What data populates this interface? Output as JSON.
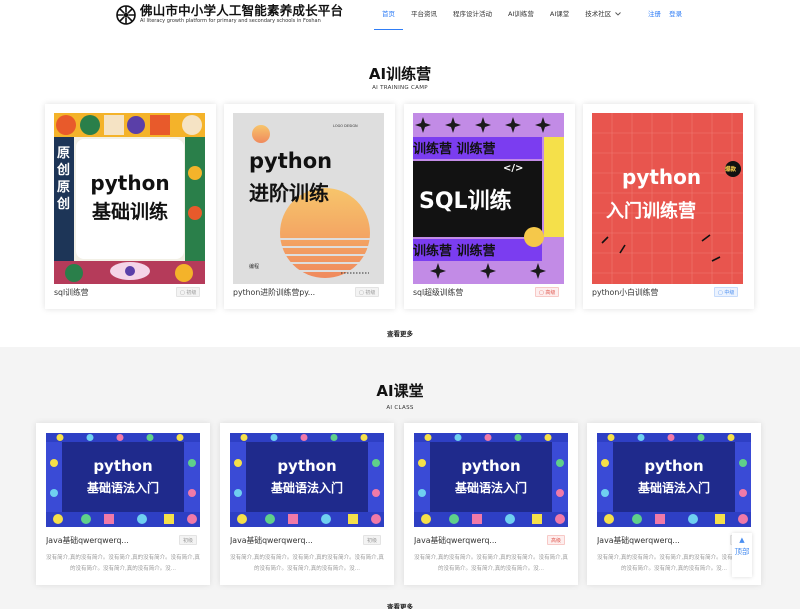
{
  "header": {
    "title": "佛山市中小学人工智能素养成长平台",
    "subtitle": "AI literacy growth platform for primary and secondary schools in Foshan",
    "nav": [
      "首页",
      "平台资讯",
      "程序设计活动",
      "AI训练营",
      "AI课堂",
      "技术社区"
    ],
    "active_nav": "首页",
    "dropdown_icon": "chevron-down-icon",
    "register": "注册",
    "login": "登录"
  },
  "camp": {
    "title": "AI训练营",
    "subtitle": "AI TRAINING CAMP",
    "more": "查看更多",
    "cards": [
      {
        "name": "sql训练营",
        "level": "初级",
        "badge_icon": "calendar-icon",
        "img_text_1": "python",
        "img_text_2": "基础训练",
        "side_1": "原",
        "side_2": "创"
      },
      {
        "name": "python进阶训练营py...",
        "level": "初级",
        "badge_icon": "calendar-icon",
        "img_text_1": "python",
        "img_text_2": "进阶训练",
        "logo": "LOGO DESIGN",
        "tag": "编程"
      },
      {
        "name": "sql超级训练营",
        "level": "高级",
        "badge_icon": "calendar-icon",
        "img_text_1": "训练营 训练营",
        "img_text_2": "SQL训练",
        "code": "</>"
      },
      {
        "name": "python小白训练营",
        "level": "中级",
        "badge_icon": "calendar-icon",
        "img_text_1": "python",
        "img_text_2": "入门训练营",
        "burst": "爆款"
      }
    ]
  },
  "class": {
    "title": "AI课堂",
    "subtitle": "AI CLASS",
    "more": "查看更多",
    "img_text_1": "python",
    "img_text_2": "基础语法入门",
    "cards": [
      {
        "name": "Java基础qwerqwerq...",
        "level": "初级",
        "desc": "没有简介,真的没有简介。没有简介,真的没有简介。没有简介,真的没有简介。没有简介,真的没有简介。没..."
      },
      {
        "name": "Java基础qwerqwerq...",
        "level": "初级",
        "desc": "没有简介,真的没有简介。没有简介,真的没有简介。没有简介,真的没有简介。没有简介,真的没有简介。没..."
      },
      {
        "name": "Java基础qwerqwerq...",
        "level": "高级",
        "desc": "没有简介,真的没有简介。没有简介,真的没有简介。没有简介,真的没有简介。没有简介,真的没有简介。没..."
      },
      {
        "name": "Java基础qwerqwerq...",
        "level": "初级",
        "desc": "没有简介,真的没有简介。没有简介,真的没有简介。没有简介,真的没有简介。没有简介,真的没有简介。没..."
      }
    ]
  },
  "to_top": {
    "label": "顶部",
    "icon": "arrow-up-icon"
  },
  "colors": {
    "accent": "#2f7df6",
    "class_banner": "#1f2a8c",
    "camp_red": "#e8554e",
    "camp_purple": "#7b3df0"
  }
}
